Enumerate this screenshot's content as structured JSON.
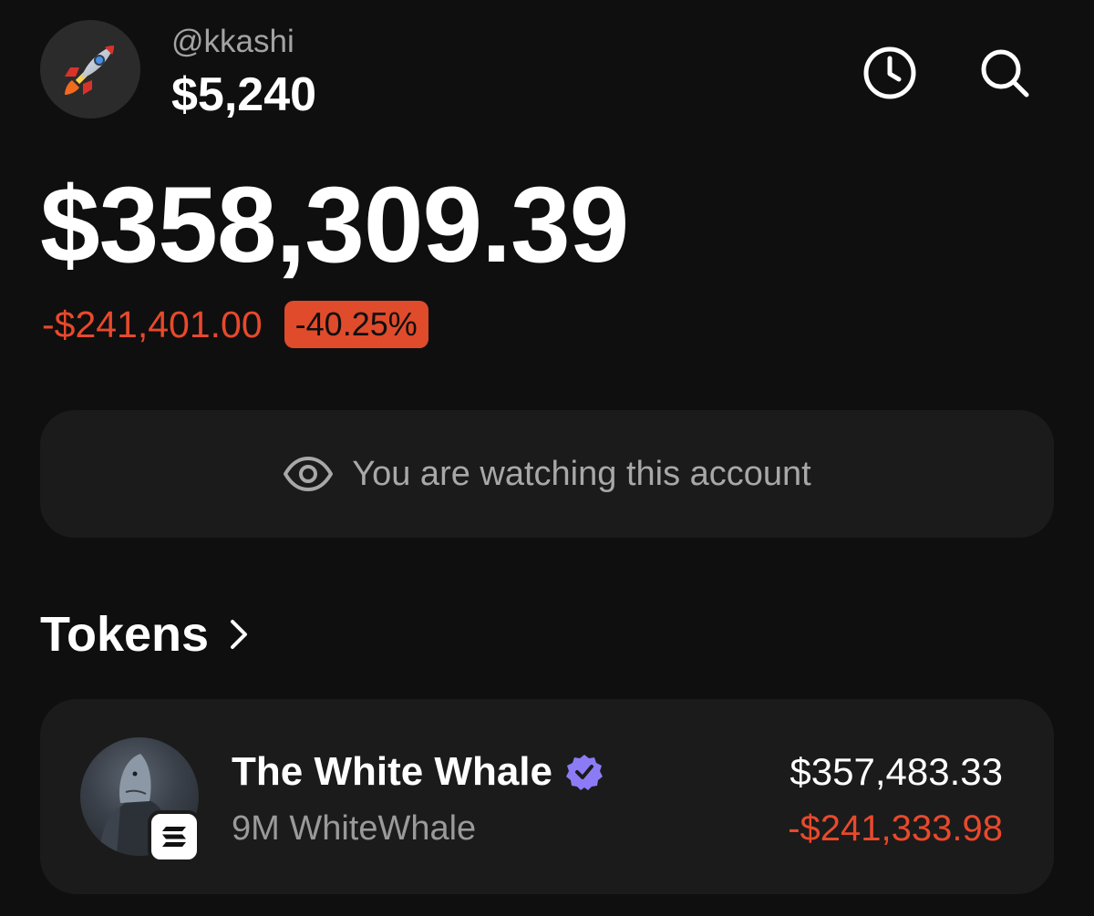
{
  "header": {
    "avatar_emoji": "rocket-icon",
    "handle": "@kkashi",
    "balance": "$5,240",
    "icons": [
      "history-clock-icon",
      "search-icon"
    ]
  },
  "portfolio": {
    "total": "$358,309.39",
    "change_amount": "-$241,401.00",
    "change_percent": "-40.25%",
    "negative_color": "#e8492c"
  },
  "watch_notice": {
    "icon": "eye-icon",
    "text": "You are watching this account"
  },
  "tokens": {
    "title": "Tokens",
    "items": [
      {
        "name": "The White Whale",
        "verified_icon": "verified-badge-icon",
        "amount_symbol": "9M WhiteWhale",
        "value": "$357,483.33",
        "change": "-$241,333.98",
        "chain_icon": "solana-icon"
      }
    ]
  },
  "colors": {
    "background": "#0f0f0f",
    "card": "#1b1b1b",
    "verified": "#8b7cf6"
  }
}
